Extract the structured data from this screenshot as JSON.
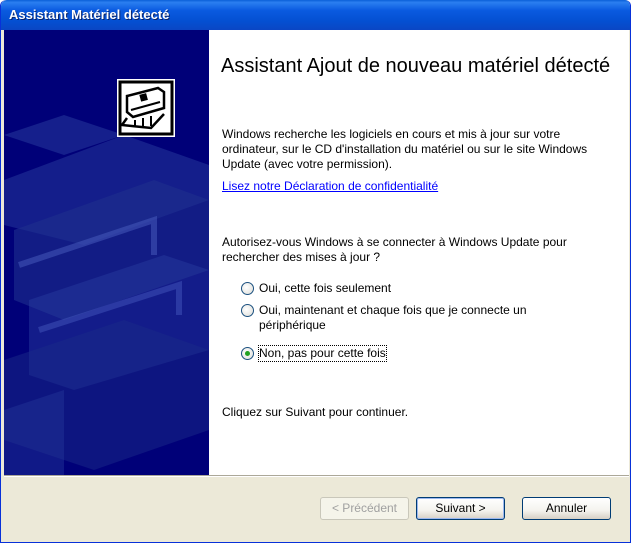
{
  "window": {
    "title": "Assistant Matériel détecté"
  },
  "main": {
    "heading": "Assistant Ajout de nouveau matériel détecté",
    "intro": "Windows recherche les logiciels en cours et mis à jour sur votre ordinateur, sur le CD d'installation du matériel ou sur le site Windows Update (avec votre permission).",
    "privacy_link": "Lisez notre Déclaration de confidentialité",
    "question": "Autorisez-vous Windows à se connecter à Windows Update pour rechercher des mises à jour ?",
    "options": [
      {
        "label": "Oui, cette fois seulement",
        "checked": false
      },
      {
        "label": "Oui, maintenant et chaque fois que je connecte un périphérique",
        "checked": false
      },
      {
        "label": "Non, pas pour cette fois",
        "checked": true
      }
    ],
    "footer_text": "Cliquez sur Suivant pour continuer."
  },
  "buttons": {
    "back": "< Précédent",
    "next": "Suivant >",
    "cancel": "Annuler"
  },
  "colors": {
    "titlebar": "#0a5ae0",
    "left_panel": "#000078",
    "link": "#0000ff",
    "radio_dot": "#21a121"
  },
  "icons": {
    "hardware": "hardware-card-icon"
  }
}
